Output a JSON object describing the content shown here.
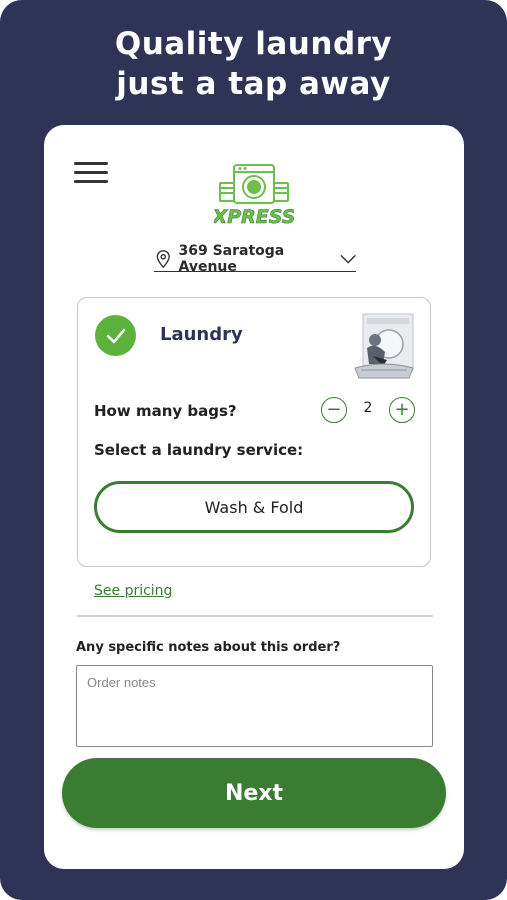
{
  "headline": {
    "line1": "Quality laundry",
    "line2": "just a tap away"
  },
  "header": {
    "menu_icon": "hamburger-menu-icon",
    "logo_text": "XPRESS",
    "logo_icon": "washing-machine-logo"
  },
  "address": {
    "icon": "location-pin-icon",
    "text": "369 Saratoga Avenue",
    "chevron": "chevron-down-icon"
  },
  "service": {
    "title": "Laundry",
    "selected": true,
    "bags_label": "How many bags?",
    "bag_count": "2",
    "decrement_symbol": "−",
    "increment_symbol": "+",
    "select_label": "Select a laundry service:",
    "selected_option": "Wash & Fold"
  },
  "pricing_link": "See pricing",
  "notes": {
    "label": "Any specific notes about this order?",
    "placeholder": "Order notes",
    "value": ""
  },
  "next_button": "Next",
  "colors": {
    "frame": "#2f3356",
    "brand_green": "#3a7d32",
    "check_green": "#5cb23d",
    "logo_green": "#6cc04a"
  }
}
